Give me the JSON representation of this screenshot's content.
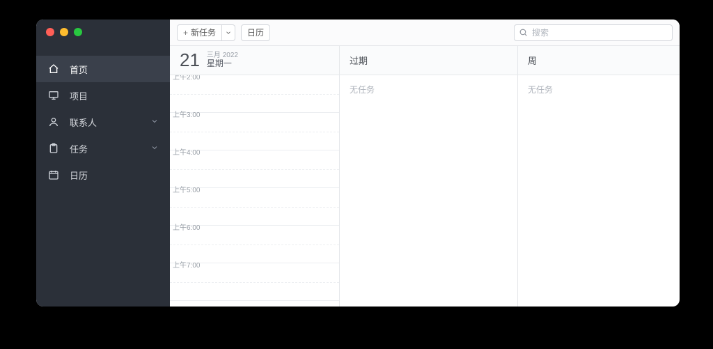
{
  "sidebar": {
    "items": [
      {
        "label": "首页",
        "icon": "home"
      },
      {
        "label": "项目",
        "icon": "presentation"
      },
      {
        "label": "联系人",
        "icon": "person",
        "expandable": true
      },
      {
        "label": "任务",
        "icon": "clipboard",
        "expandable": true
      },
      {
        "label": "日历",
        "icon": "calendar"
      }
    ]
  },
  "toolbar": {
    "new_task_label": "新任务",
    "calendar_label": "日历",
    "search_placeholder": "搜索"
  },
  "columns": {
    "today": {
      "day_number": "21",
      "month_year": "三月 2022",
      "weekday": "星期一",
      "time_labels": [
        "上午2:00",
        "上午3:00",
        "上午4:00",
        "上午5:00",
        "上午6:00",
        "上午7:00"
      ]
    },
    "overdue": {
      "title": "过期",
      "empty": "无任务"
    },
    "week": {
      "title": "周",
      "empty": "无任务"
    }
  }
}
